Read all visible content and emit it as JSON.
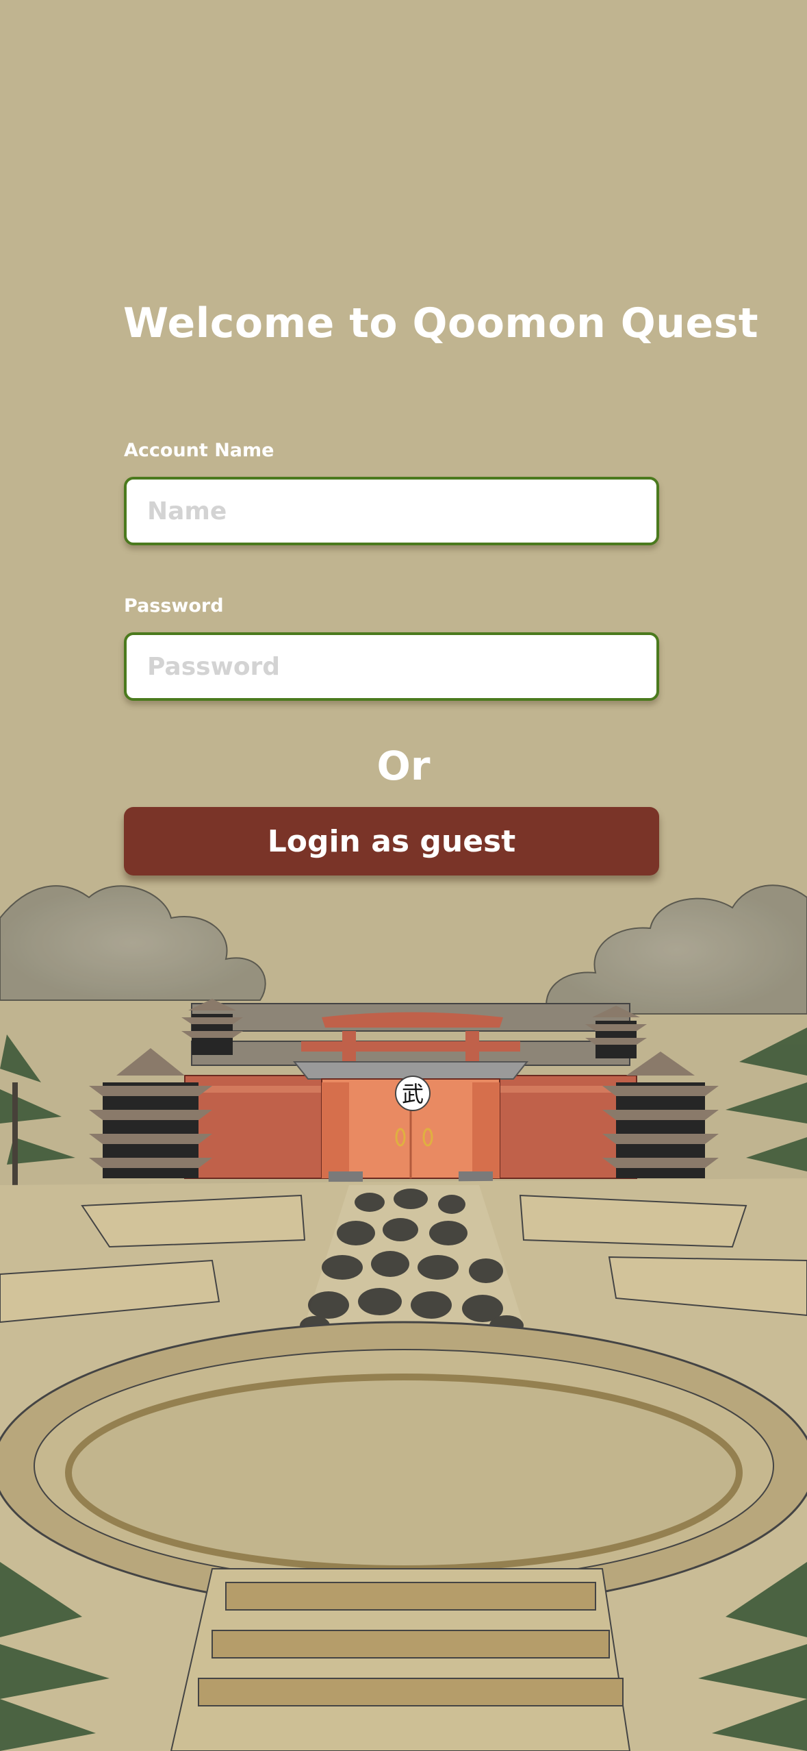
{
  "login": {
    "title": "Welcome to Qoomon Quest",
    "account_label": "Account Name",
    "account_placeholder": "Name",
    "account_value": "",
    "password_label": "Password",
    "password_placeholder": "Password",
    "password_value": "",
    "divider_text": "Or",
    "guest_button_label": "Login as guest"
  },
  "scene": {
    "gate_symbol": "武"
  },
  "colors": {
    "background": "#c0b490",
    "input_border": "#4b7a1e",
    "guest_button": "#7a3428",
    "temple_red": "#c0614a",
    "pagoda_dark": "#262626"
  }
}
